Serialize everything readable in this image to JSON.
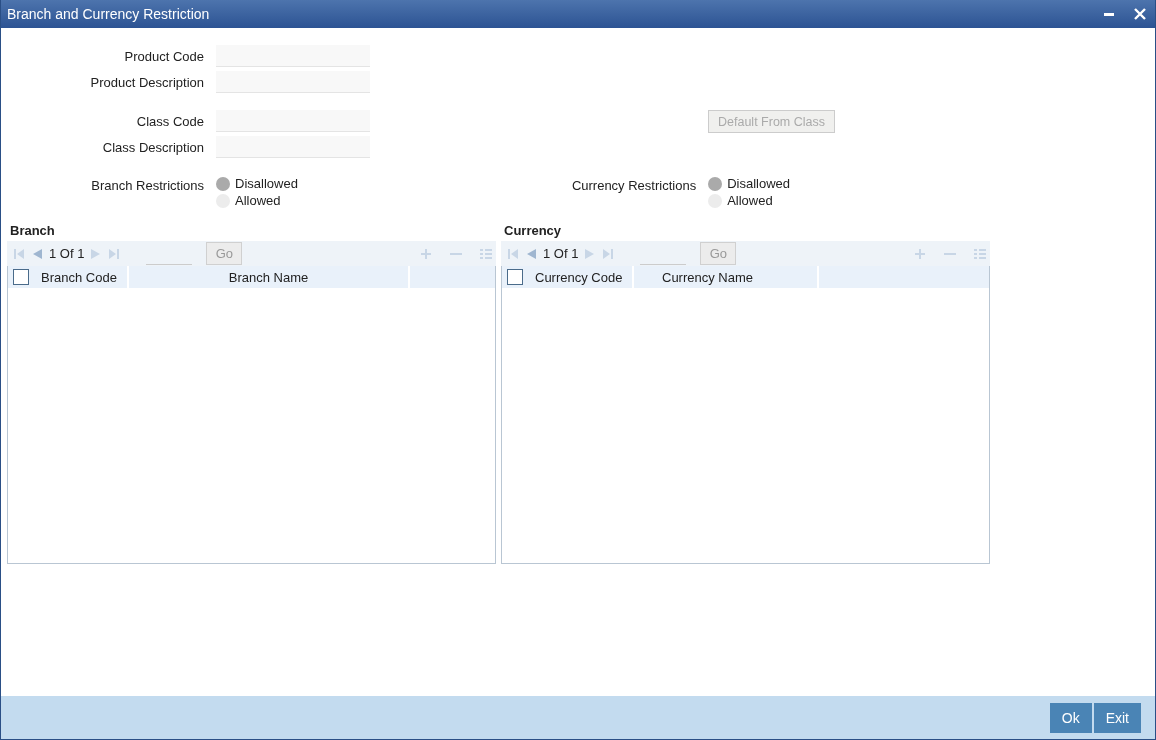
{
  "window": {
    "title": "Branch and Currency Restriction"
  },
  "fields": [
    {
      "label": "Product Code"
    },
    {
      "label": "Product Description"
    },
    {
      "label": "Class Code"
    },
    {
      "label": "Class Description"
    }
  ],
  "default_button": {
    "label": "Default From Class",
    "disabled": true
  },
  "restrictions": [
    {
      "label": "Branch Restrictions",
      "options": [
        {
          "label": "Disallowed",
          "selected": true
        },
        {
          "label": "Allowed",
          "selected": false
        }
      ]
    },
    {
      "label": "Currency Restrictions",
      "options": [
        {
          "label": "Disallowed",
          "selected": true
        },
        {
          "label": "Allowed",
          "selected": false
        }
      ]
    }
  ],
  "grids": [
    {
      "title": "Branch",
      "page": "1 Of 1",
      "go": "Go",
      "select_all": false,
      "columns": [
        "Branch Code",
        "Branch Name"
      ]
    },
    {
      "title": "Currency",
      "page": "1 Of 1",
      "go": "Go",
      "select_all": false,
      "columns": [
        "Currency Code",
        "Currency Name"
      ]
    }
  ],
  "buttons": [
    "Ok",
    "Exit"
  ]
}
